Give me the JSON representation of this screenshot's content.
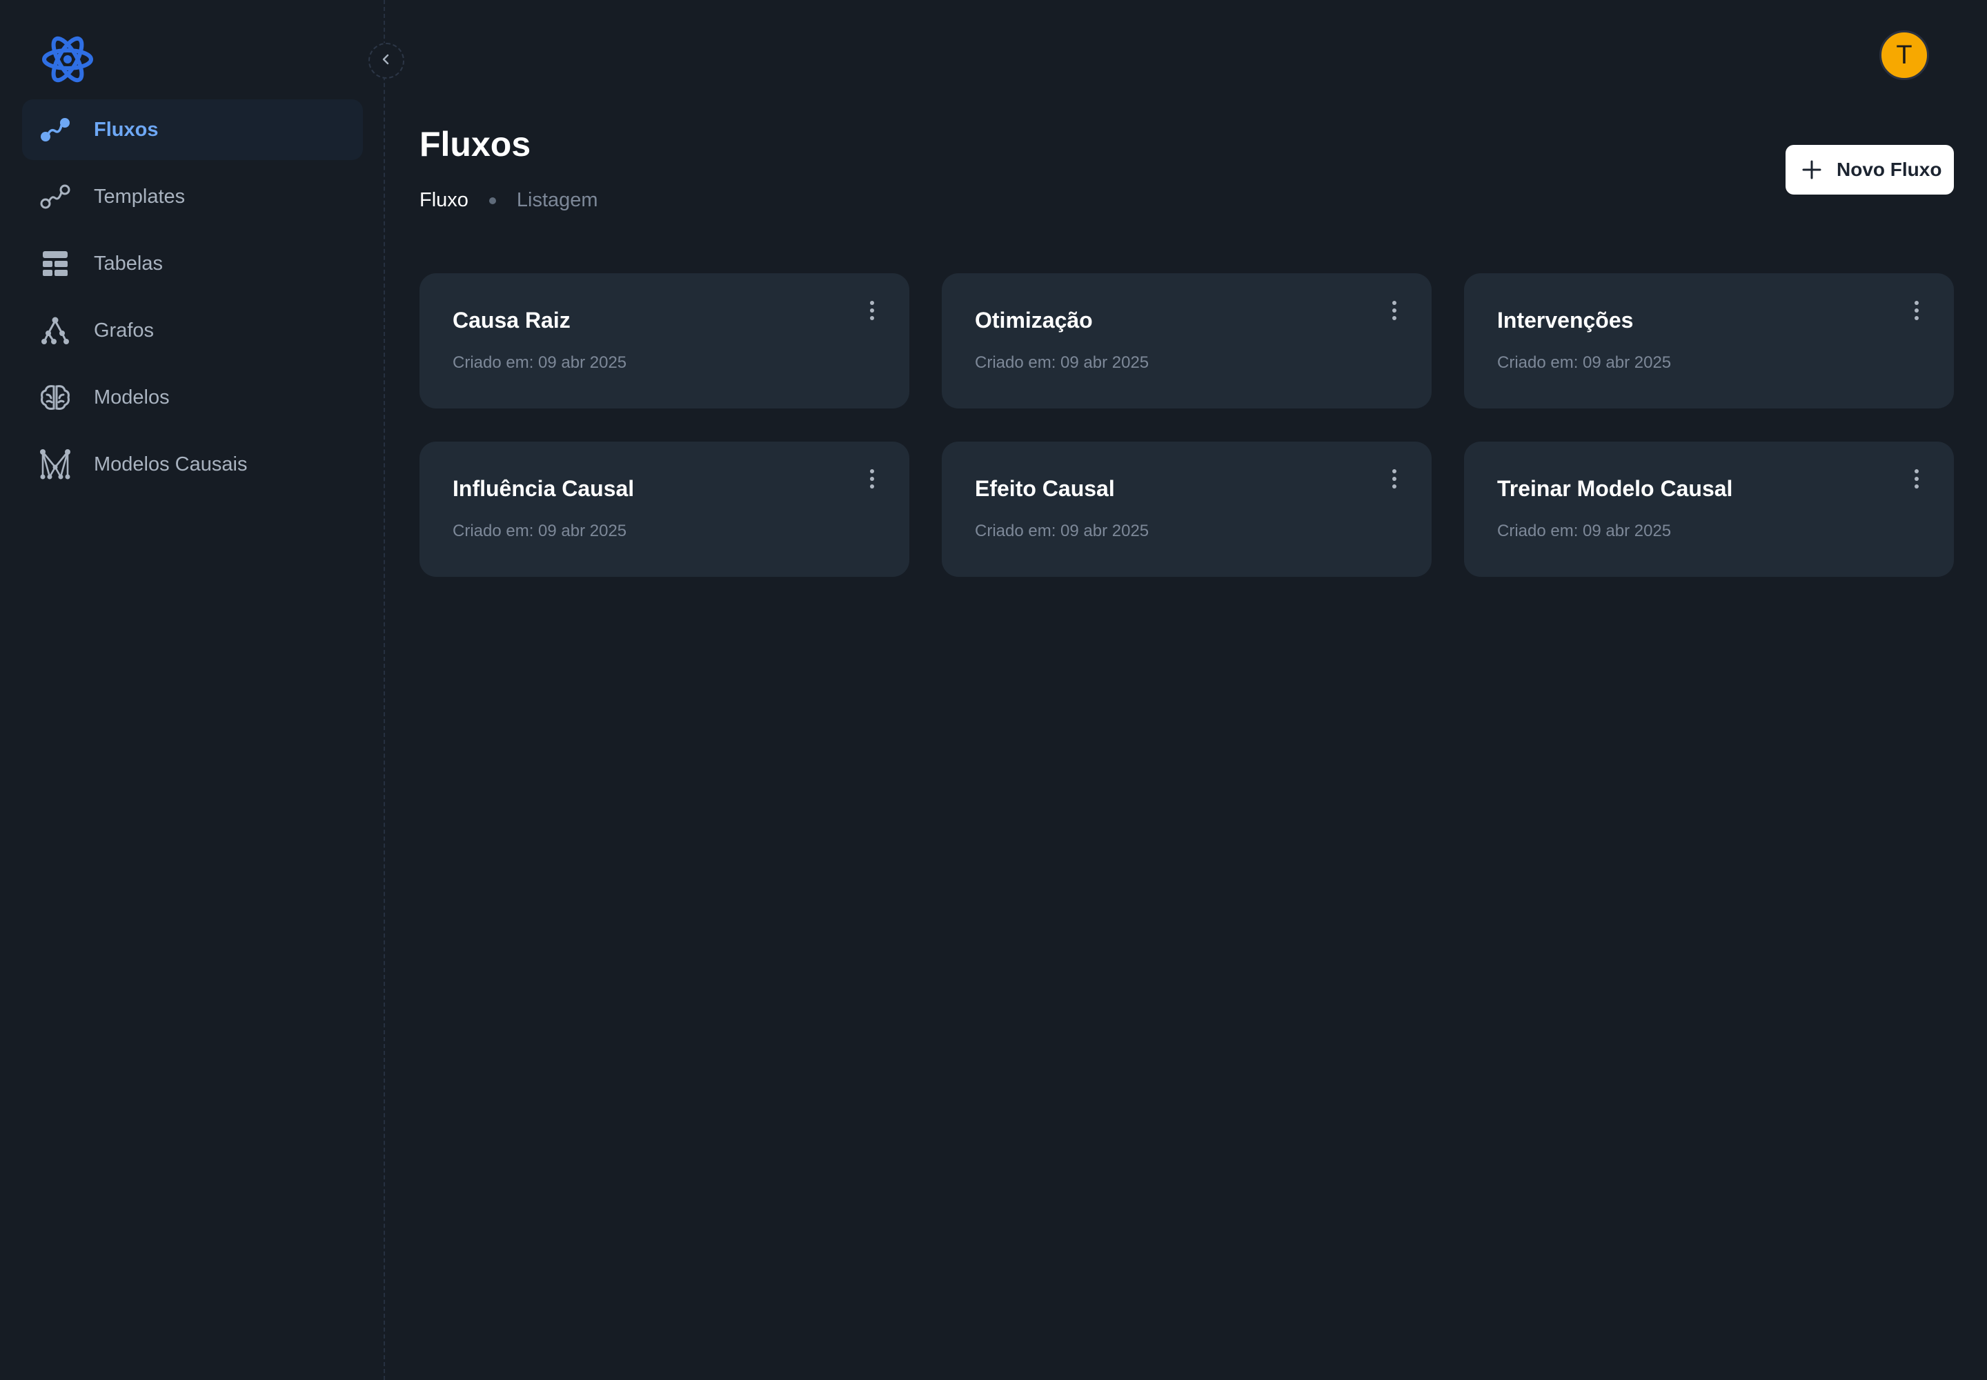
{
  "sidebar": {
    "logo_icon": "atom-logo-icon",
    "collapse_icon": "chevron-left-icon",
    "items": [
      {
        "label": "Fluxos",
        "icon": "flow-icon",
        "active": true
      },
      {
        "label": "Templates",
        "icon": "template-flow-icon",
        "active": false
      },
      {
        "label": "Tabelas",
        "icon": "table-icon",
        "active": false
      },
      {
        "label": "Grafos",
        "icon": "graph-icon",
        "active": false
      },
      {
        "label": "Modelos",
        "icon": "brain-icon",
        "active": false
      },
      {
        "label": "Modelos Causais",
        "icon": "causal-network-icon",
        "active": false
      }
    ]
  },
  "header": {
    "avatar_letter": "T",
    "avatar_color": "#F7A800"
  },
  "main": {
    "title": "Fluxos",
    "breadcrumb": [
      "Fluxo",
      "Listagem"
    ],
    "new_button_label": "Novo Fluxo",
    "cards": [
      {
        "title": "Causa Raiz",
        "date": "Criado em: 09 abr 2025"
      },
      {
        "title": "Otimização",
        "date": "Criado em: 09 abr 2025"
      },
      {
        "title": "Intervenções",
        "date": "Criado em: 09 abr 2025"
      },
      {
        "title": "Influência Causal",
        "date": "Criado em: 09 abr 2025"
      },
      {
        "title": "Efeito Causal",
        "date": "Criado em: 09 abr 2025"
      },
      {
        "title": "Treinar Modelo Causal",
        "date": "Criado em: 09 abr 2025"
      }
    ]
  },
  "colors": {
    "background": "#161C24",
    "card": "#212B36",
    "accent": "#6EA8F5",
    "logo": "#2F6FE4"
  }
}
